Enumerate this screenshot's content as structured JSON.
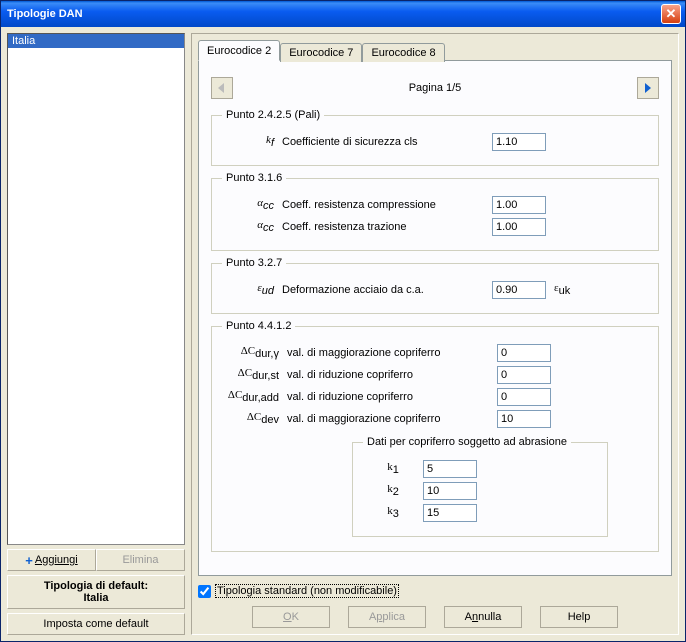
{
  "window": {
    "title": "Tipologie DAN"
  },
  "list": {
    "items": [
      "Italia"
    ],
    "selected": 0
  },
  "buttons": {
    "add": "Aggiungi",
    "delete": "Elimina",
    "setdefault": "Imposta come default",
    "ok": "OK",
    "apply": "Applica",
    "cancel": "Annulla",
    "help": "Help"
  },
  "default": {
    "label": "Tipologia di default:",
    "value": "Italia"
  },
  "tabs": [
    "Eurocodice 2",
    "Eurocodice 7",
    "Eurocodice 8"
  ],
  "active_tab": 0,
  "pager": {
    "label": "Pagina 1/5"
  },
  "sections": {
    "s1": {
      "legend": "Punto 2.4.2.5 (Pali)",
      "kf_sym": "k",
      "kf_sub": "f",
      "kf_lbl": "Coefficiente di sicurezza cls",
      "kf_val": "1.10"
    },
    "s2": {
      "legend": "Punto 3.1.6",
      "acc_sym": "αcc",
      "r1_lbl": "Coeff. resistenza compressione",
      "r1_val": "1.00",
      "r2_lbl": "Coeff. resistenza trazione",
      "r2_val": "1.00"
    },
    "s3": {
      "legend": "Punto 3.2.7",
      "eud_sym": "εud",
      "eud_lbl": "Deformazione acciaio da c.a.",
      "eud_val": "0.90",
      "euk_sym": "εuk"
    },
    "s4": {
      "legend": "Punto 4.4.1.2",
      "r1_sym": "ΔCdur,γ",
      "r1_lbl": "val. di maggiorazione copriferro",
      "r1_val": "0",
      "r2_sym": "ΔCdur,st",
      "r2_lbl": "val. di riduzione copriferro",
      "r2_val": "0",
      "r3_sym": "ΔCdur,add",
      "r3_lbl": "val. di riduzione copriferro",
      "r3_val": "0",
      "r4_sym": "ΔCdev",
      "r4_lbl": "val. di maggiorazione copriferro",
      "r4_val": "10",
      "inner_legend": "Dati per copriferro soggetto ad abrasione",
      "k1_lbl": "k1",
      "k1_val": "5",
      "k2_lbl": "k2",
      "k2_val": "10",
      "k3_lbl": "k3",
      "k3_val": "15"
    }
  },
  "checkbox": {
    "label": "Tipologia standard (non modificabile)",
    "checked": true
  }
}
